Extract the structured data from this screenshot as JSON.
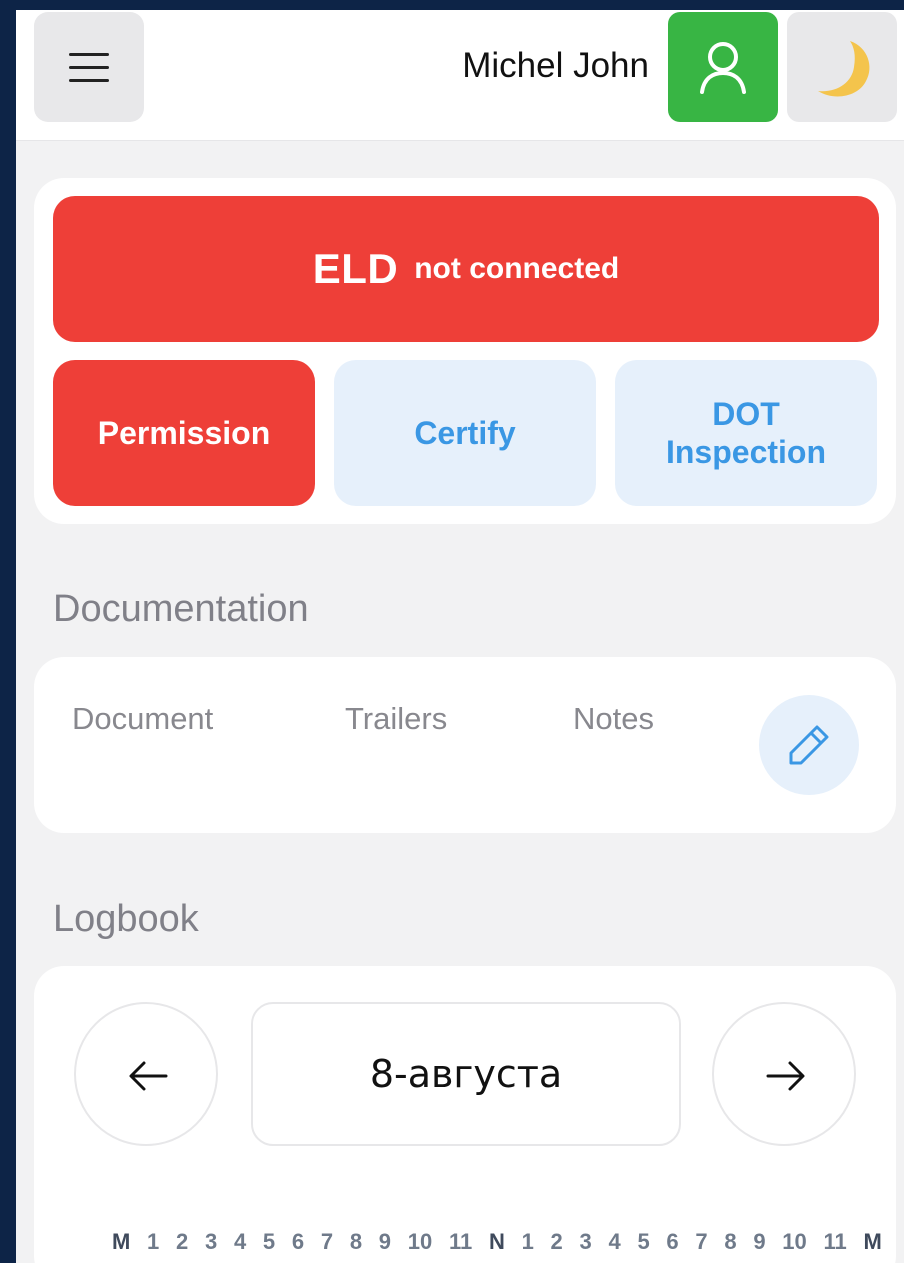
{
  "header": {
    "user_name": "Michel John",
    "icons": {
      "menu": "hamburger-icon",
      "profile": "user-icon",
      "theme": "moon-icon"
    },
    "profile_color": "#38b544"
  },
  "status": {
    "eld_label": "ELD",
    "eld_status": "not connected",
    "alert_color": "#ee3f38"
  },
  "actions": {
    "permission": "Permission",
    "certify": "Certify",
    "dot_line1": "DOT",
    "dot_line2": "Inspection"
  },
  "documentation": {
    "title": "Documentation",
    "columns": [
      "Document",
      "Trailers",
      "Notes"
    ],
    "edit_icon": "pencil-icon"
  },
  "logbook": {
    "title": "Logbook",
    "date": "8-августа",
    "prev_icon": "arrow-left-icon",
    "next_icon": "arrow-right-icon",
    "hours": [
      "M",
      "1",
      "2",
      "3",
      "4",
      "5",
      "6",
      "7",
      "8",
      "9",
      "10",
      "11",
      "N",
      "1",
      "2",
      "3",
      "4",
      "5",
      "6",
      "7",
      "8",
      "9",
      "10",
      "11",
      "M"
    ]
  }
}
